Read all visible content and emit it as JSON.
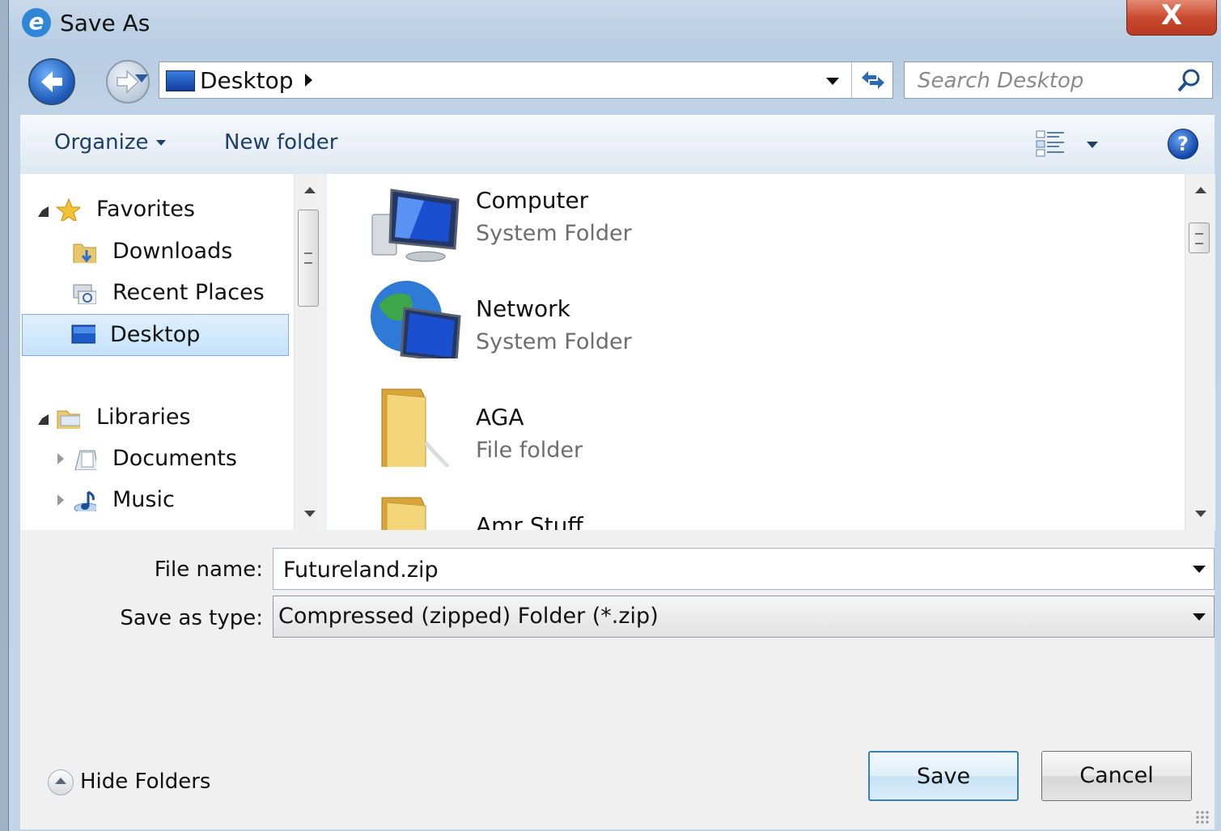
{
  "window": {
    "title": "Save As",
    "close_label": "X"
  },
  "address": {
    "location": "Desktop"
  },
  "search": {
    "placeholder": "Search Desktop"
  },
  "toolbar": {
    "organize_label": "Organize",
    "new_folder_label": "New folder",
    "help_label": "?"
  },
  "nav": {
    "favorites": {
      "label": "Favorites",
      "items": [
        {
          "label": "Downloads"
        },
        {
          "label": "Recent Places"
        },
        {
          "label": "Desktop",
          "selected": true
        }
      ]
    },
    "libraries": {
      "label": "Libraries",
      "items": [
        {
          "label": "Documents"
        },
        {
          "label": "Music"
        }
      ]
    }
  },
  "files": [
    {
      "name": "Computer",
      "type": "System Folder",
      "icon": "computer-icon"
    },
    {
      "name": "Network",
      "type": "System Folder",
      "icon": "network-icon"
    },
    {
      "name": "AGA",
      "type": "File folder",
      "icon": "folder-icon"
    },
    {
      "name": "Amr Stuff",
      "type": "",
      "icon": "folder-icon"
    }
  ],
  "form": {
    "file_name_label": "File name:",
    "file_name_value": "Futureland.zip",
    "save_type_label": "Save as type:",
    "save_type_value": "Compressed (zipped) Folder (*.zip)"
  },
  "footer": {
    "hide_folders_label": "Hide Folders",
    "save_label": "Save",
    "cancel_label": "Cancel"
  },
  "colors": {
    "selection": "#c5e2fa",
    "title_bg": "#bfd2e6",
    "close_red": "#c8492e",
    "accent_blue": "#2c68b6"
  }
}
